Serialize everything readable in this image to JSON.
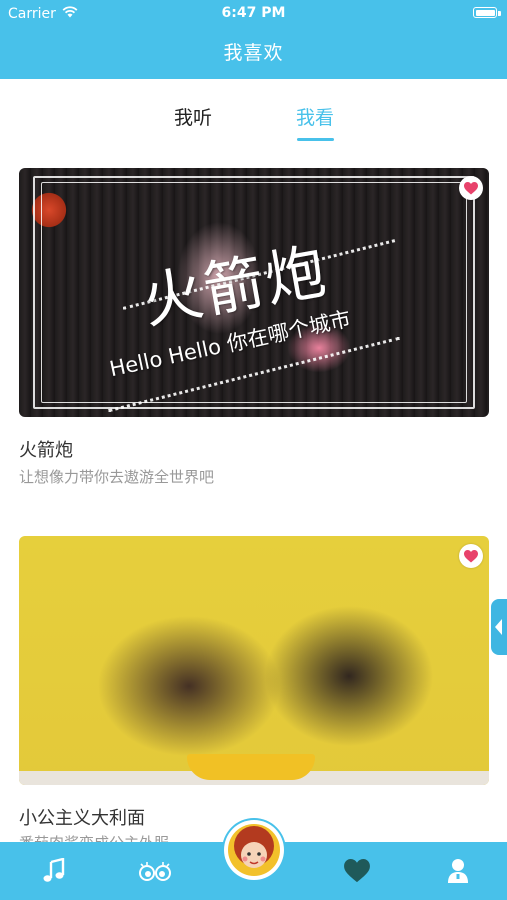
{
  "status_bar": {
    "carrier": "Carrier",
    "time": "6:47 PM"
  },
  "nav": {
    "title": "我喜欢"
  },
  "tabs": [
    {
      "label": "我听",
      "active": false
    },
    {
      "label": "我看",
      "active": true
    }
  ],
  "cards": [
    {
      "title": "火箭炮",
      "description": "让想像力带你去遨游全世界吧",
      "thumb_text": {
        "main": "火箭炮",
        "sub": "Hello Hello 你在哪个城市"
      },
      "favorited": true
    },
    {
      "title": "小公主义大利面",
      "description": "番茄肉酱变成公主外服",
      "favorited": true
    }
  ],
  "tabbar": {
    "items": [
      {
        "icon": "music-note-icon"
      },
      {
        "icon": "eyes-icon"
      },
      {
        "icon": "avatar-home-icon"
      },
      {
        "icon": "heart-icon"
      },
      {
        "icon": "user-icon"
      }
    ]
  },
  "colors": {
    "accent": "#48c1ea",
    "heart": "#e8426b",
    "tabbar_heart": "#1f5a5a"
  }
}
